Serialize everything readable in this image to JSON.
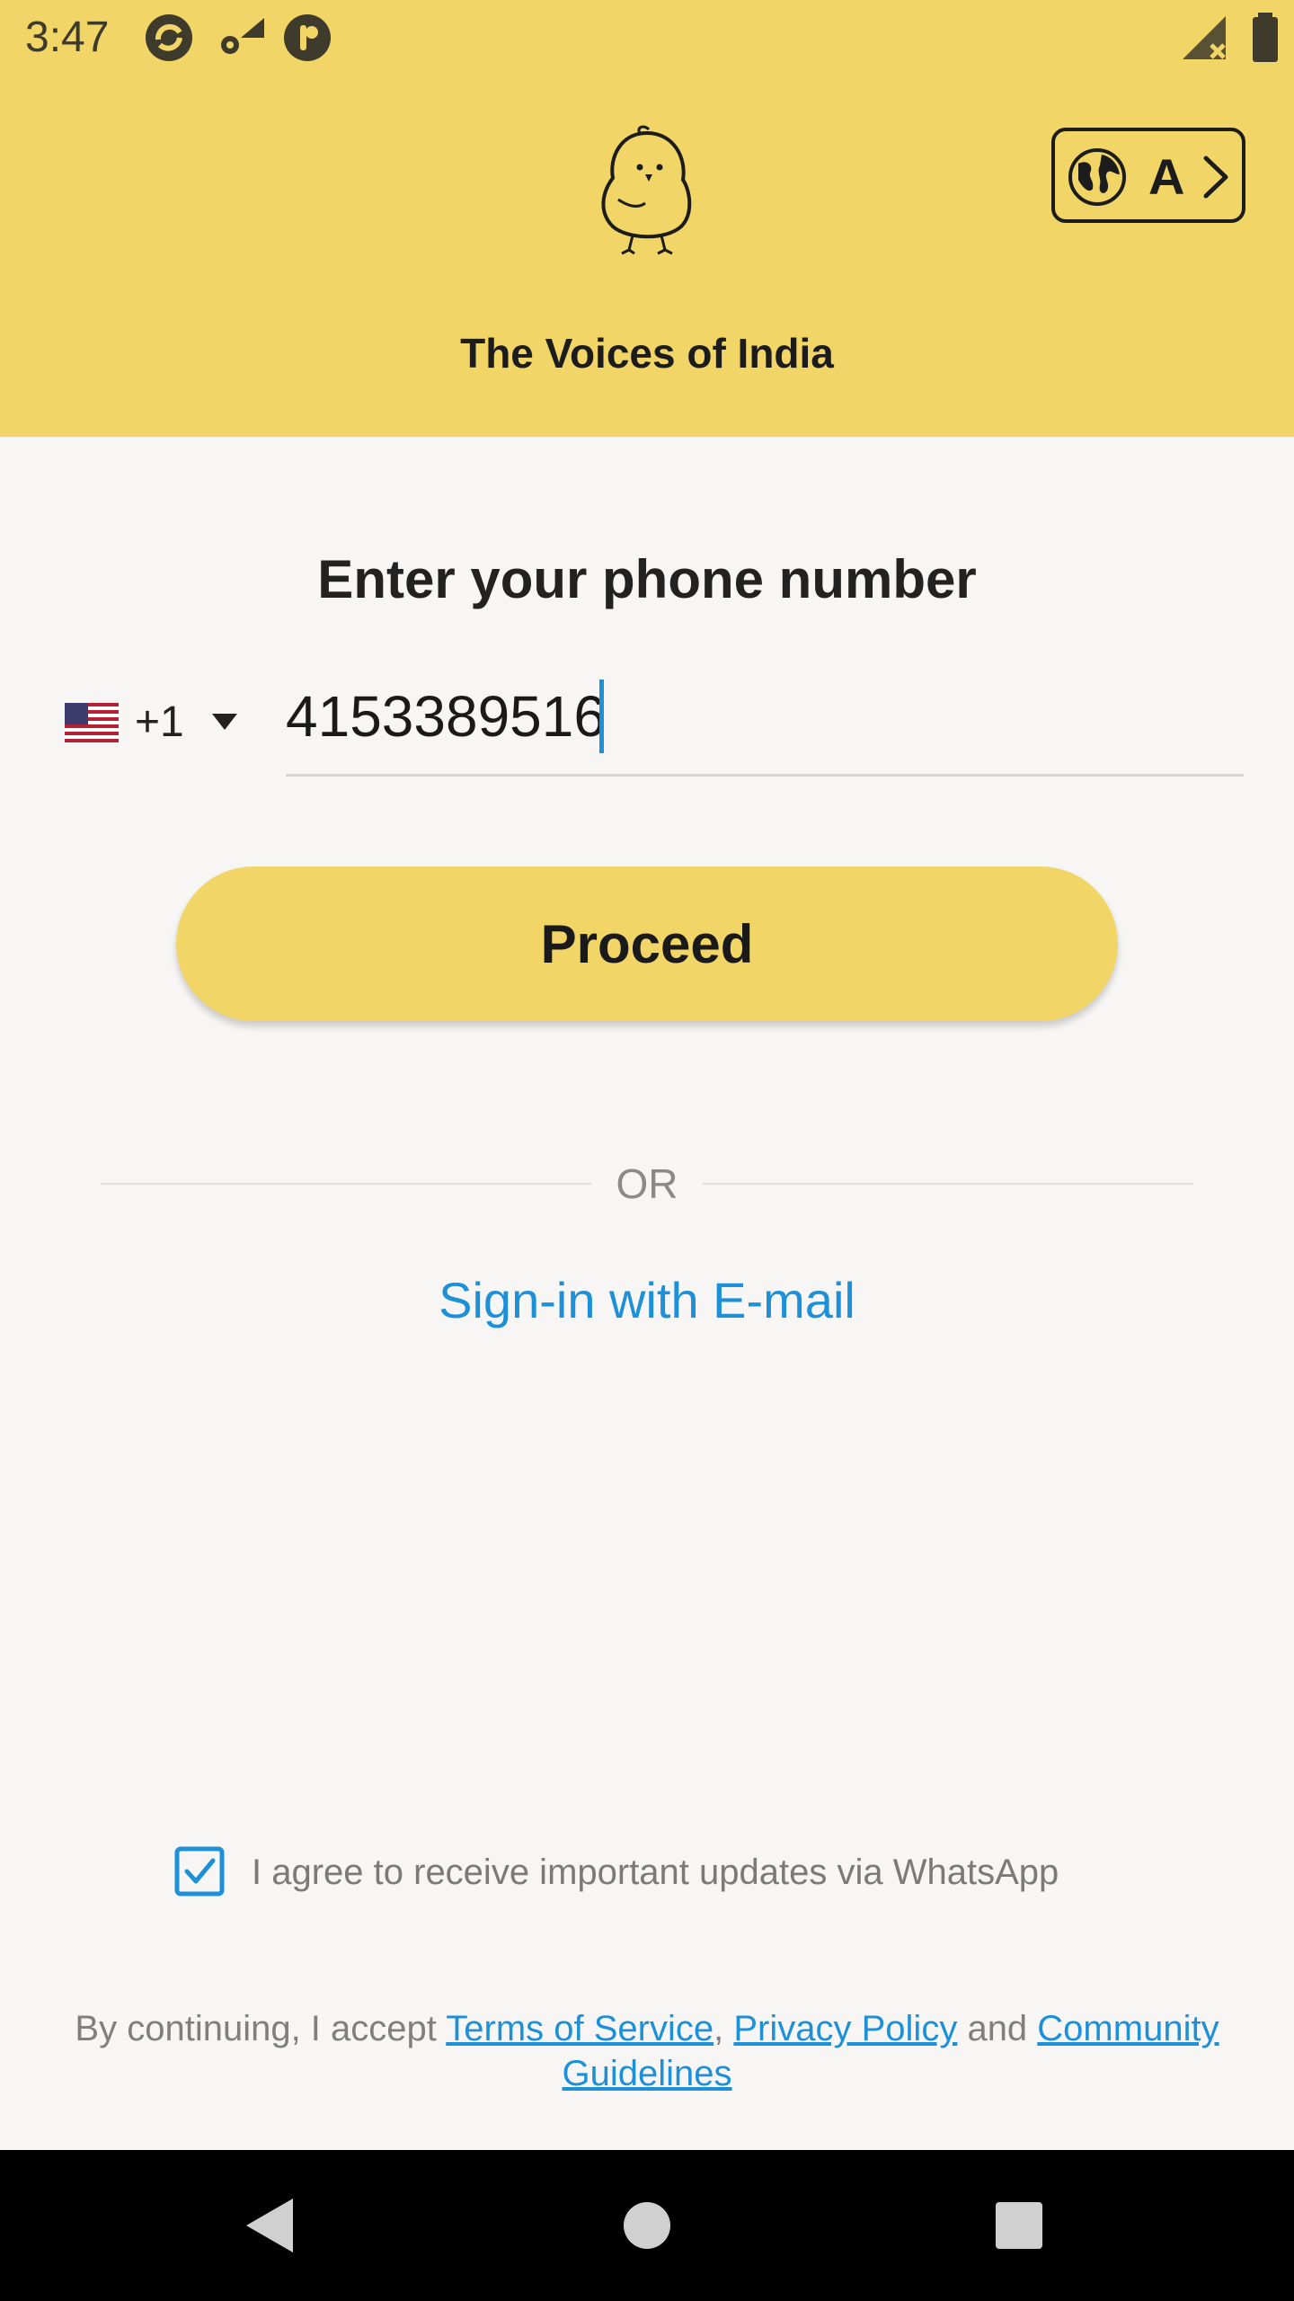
{
  "status_bar": {
    "time": "3:47",
    "icons": [
      "sync-icon",
      "settings-wifi-icon",
      "accessibility-icon",
      "no-signal-icon",
      "battery-icon"
    ]
  },
  "header": {
    "tagline": "The Voices of India",
    "language_button": {
      "letter": "A",
      "icons": [
        "globe-icon",
        "chevron-right-icon"
      ]
    },
    "logo": "koo-bird-logo"
  },
  "main": {
    "title": "Enter your phone number",
    "country_code": "+1",
    "country_flag": "us-flag-icon",
    "phone_value": "4153389516",
    "proceed_label": "Proceed",
    "or_label": "OR",
    "email_signin_label": "Sign-in with E-mail"
  },
  "consent": {
    "checked": true,
    "whatsapp_label": "I agree to receive important updates via WhatsApp"
  },
  "legal": {
    "prefix": "By continuing, I accept ",
    "terms": "Terms of Service",
    "comma": ", ",
    "privacy": "Privacy Policy",
    "and": " and ",
    "community": "Community Guidelines"
  },
  "nav": {
    "icons": [
      "back-icon",
      "home-icon",
      "recents-icon"
    ]
  },
  "colors": {
    "brand_yellow": "#f1d566",
    "link_blue": "#1d90d8",
    "background": "#f7f6f4"
  }
}
